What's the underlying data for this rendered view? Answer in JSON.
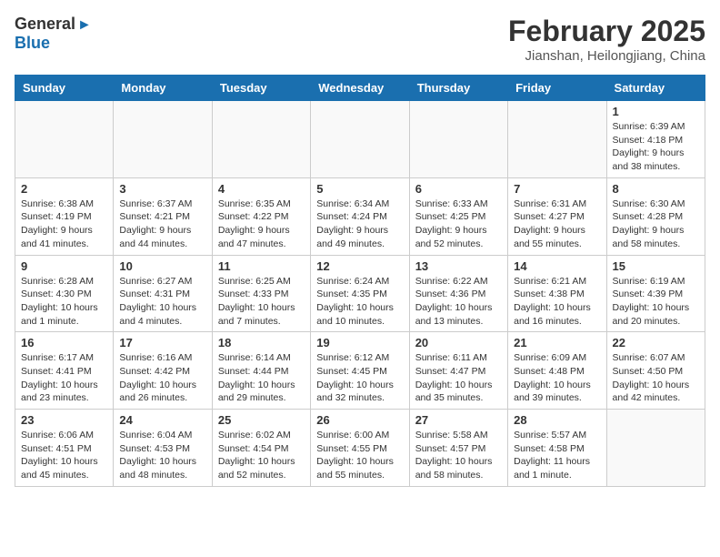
{
  "header": {
    "logo_general": "General",
    "logo_blue": "Blue",
    "month_title": "February 2025",
    "subtitle": "Jianshan, Heilongjiang, China"
  },
  "weekdays": [
    "Sunday",
    "Monday",
    "Tuesday",
    "Wednesday",
    "Thursday",
    "Friday",
    "Saturday"
  ],
  "weeks": [
    [
      {
        "day": "",
        "empty": true
      },
      {
        "day": "",
        "empty": true
      },
      {
        "day": "",
        "empty": true
      },
      {
        "day": "",
        "empty": true
      },
      {
        "day": "",
        "empty": true
      },
      {
        "day": "",
        "empty": true
      },
      {
        "day": "1",
        "detail": "Sunrise: 6:39 AM\nSunset: 4:18 PM\nDaylight: 9 hours\nand 38 minutes."
      }
    ],
    [
      {
        "day": "2",
        "detail": "Sunrise: 6:38 AM\nSunset: 4:19 PM\nDaylight: 9 hours\nand 41 minutes."
      },
      {
        "day": "3",
        "detail": "Sunrise: 6:37 AM\nSunset: 4:21 PM\nDaylight: 9 hours\nand 44 minutes."
      },
      {
        "day": "4",
        "detail": "Sunrise: 6:35 AM\nSunset: 4:22 PM\nDaylight: 9 hours\nand 47 minutes."
      },
      {
        "day": "5",
        "detail": "Sunrise: 6:34 AM\nSunset: 4:24 PM\nDaylight: 9 hours\nand 49 minutes."
      },
      {
        "day": "6",
        "detail": "Sunrise: 6:33 AM\nSunset: 4:25 PM\nDaylight: 9 hours\nand 52 minutes."
      },
      {
        "day": "7",
        "detail": "Sunrise: 6:31 AM\nSunset: 4:27 PM\nDaylight: 9 hours\nand 55 minutes."
      },
      {
        "day": "8",
        "detail": "Sunrise: 6:30 AM\nSunset: 4:28 PM\nDaylight: 9 hours\nand 58 minutes."
      }
    ],
    [
      {
        "day": "9",
        "detail": "Sunrise: 6:28 AM\nSunset: 4:30 PM\nDaylight: 10 hours\nand 1 minute."
      },
      {
        "day": "10",
        "detail": "Sunrise: 6:27 AM\nSunset: 4:31 PM\nDaylight: 10 hours\nand 4 minutes."
      },
      {
        "day": "11",
        "detail": "Sunrise: 6:25 AM\nSunset: 4:33 PM\nDaylight: 10 hours\nand 7 minutes."
      },
      {
        "day": "12",
        "detail": "Sunrise: 6:24 AM\nSunset: 4:35 PM\nDaylight: 10 hours\nand 10 minutes."
      },
      {
        "day": "13",
        "detail": "Sunrise: 6:22 AM\nSunset: 4:36 PM\nDaylight: 10 hours\nand 13 minutes."
      },
      {
        "day": "14",
        "detail": "Sunrise: 6:21 AM\nSunset: 4:38 PM\nDaylight: 10 hours\nand 16 minutes."
      },
      {
        "day": "15",
        "detail": "Sunrise: 6:19 AM\nSunset: 4:39 PM\nDaylight: 10 hours\nand 20 minutes."
      }
    ],
    [
      {
        "day": "16",
        "detail": "Sunrise: 6:17 AM\nSunset: 4:41 PM\nDaylight: 10 hours\nand 23 minutes."
      },
      {
        "day": "17",
        "detail": "Sunrise: 6:16 AM\nSunset: 4:42 PM\nDaylight: 10 hours\nand 26 minutes."
      },
      {
        "day": "18",
        "detail": "Sunrise: 6:14 AM\nSunset: 4:44 PM\nDaylight: 10 hours\nand 29 minutes."
      },
      {
        "day": "19",
        "detail": "Sunrise: 6:12 AM\nSunset: 4:45 PM\nDaylight: 10 hours\nand 32 minutes."
      },
      {
        "day": "20",
        "detail": "Sunrise: 6:11 AM\nSunset: 4:47 PM\nDaylight: 10 hours\nand 35 minutes."
      },
      {
        "day": "21",
        "detail": "Sunrise: 6:09 AM\nSunset: 4:48 PM\nDaylight: 10 hours\nand 39 minutes."
      },
      {
        "day": "22",
        "detail": "Sunrise: 6:07 AM\nSunset: 4:50 PM\nDaylight: 10 hours\nand 42 minutes."
      }
    ],
    [
      {
        "day": "23",
        "detail": "Sunrise: 6:06 AM\nSunset: 4:51 PM\nDaylight: 10 hours\nand 45 minutes."
      },
      {
        "day": "24",
        "detail": "Sunrise: 6:04 AM\nSunset: 4:53 PM\nDaylight: 10 hours\nand 48 minutes."
      },
      {
        "day": "25",
        "detail": "Sunrise: 6:02 AM\nSunset: 4:54 PM\nDaylight: 10 hours\nand 52 minutes."
      },
      {
        "day": "26",
        "detail": "Sunrise: 6:00 AM\nSunset: 4:55 PM\nDaylight: 10 hours\nand 55 minutes."
      },
      {
        "day": "27",
        "detail": "Sunrise: 5:58 AM\nSunset: 4:57 PM\nDaylight: 10 hours\nand 58 minutes."
      },
      {
        "day": "28",
        "detail": "Sunrise: 5:57 AM\nSunset: 4:58 PM\nDaylight: 11 hours\nand 1 minute."
      },
      {
        "day": "",
        "empty": true
      }
    ]
  ]
}
